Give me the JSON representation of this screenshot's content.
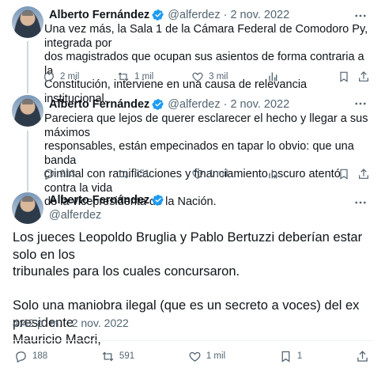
{
  "tweets": [
    {
      "author": "Alberto Fernández",
      "handle": "@alferdez",
      "separator": "·",
      "date": "2 nov. 2022",
      "text": "Una vez más, la Sala 1 de la Cámara Federal de Comodoro Py, integrada por dos magistrados que ocupan sus asientos de forma contraria a la Constitución, interviene en una causa de relevancia institucional.",
      "lines": [
        "Una vez más, la Sala 1 de la Cámara Federal de Comodoro Py, integrada por",
        "dos magistrados que ocupan sus asientos de forma contraria a la",
        "Constitución, interviene en una causa de relevancia institucional."
      ],
      "replies": "2 mil",
      "retweets": "1 mil",
      "likes": "3 mil"
    },
    {
      "author": "Alberto Fernández",
      "handle": "@alferdez",
      "separator": "·",
      "date": "2 nov. 2022",
      "lines": [
        "Pareciera que lejos de querer esclarecer el hecho y llegar a sus máximos",
        "responsables, están empecinados en tapar lo obvio: que una banda",
        "criminal con ramificaciones y financiamiento oscuro atentó contra la vida",
        "de la vicepresidenta de la Nación."
      ],
      "replies": "213",
      "retweets": "551",
      "likes": "1 mil"
    },
    {
      "author": "Alberto Fernández",
      "handle": "@alferdez",
      "paragraphs": [
        "Los jueces Leopoldo Bruglia y Pablo Bertuzzi deberían estar solo en los tribunales para los cuales concursaron.",
        "Solo una maniobra ilegal (que es un secreto a voces) del ex presidente Mauricio Macri,"
      ],
      "para1_lines": [
        "Los jueces Leopoldo Bruglia y Pablo Bertuzzi deberían estar solo en los",
        "tribunales para los cuales concursaron."
      ],
      "para2_lines": [
        "Solo una maniobra ilegal (que es un secreto a voces) del ex presidente",
        "Mauricio Macri,"
      ],
      "timestamp": "4:42 p. m. · 2 nov. 2022",
      "replies": "188",
      "retweets": "591",
      "likes": "1 mil",
      "bookmarks": "1"
    }
  ],
  "icons": {
    "verified": "verified-badge-icon",
    "more": "more-options-icon",
    "reply": "reply-icon",
    "retweet": "retweet-icon",
    "like": "like-icon",
    "views": "views-icon",
    "bookmark": "bookmark-icon",
    "share": "share-icon"
  },
  "colors": {
    "verified": "#1d9bf0",
    "secondary_text": "#536471",
    "thread_line": "#cfd9de"
  }
}
